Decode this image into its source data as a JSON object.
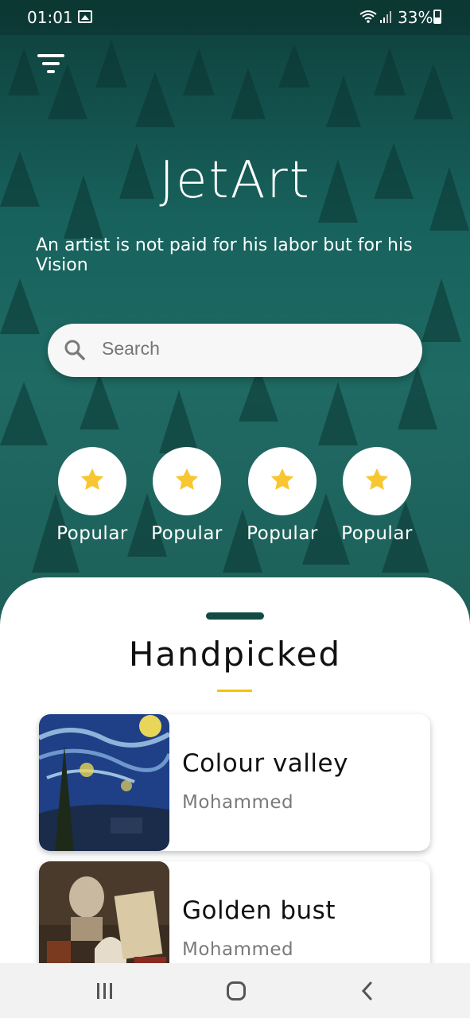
{
  "status": {
    "time": "01:01",
    "battery": "33%"
  },
  "app": {
    "title": "JetArt",
    "tagline": "An artist is not paid for his labor but for his Vision"
  },
  "search": {
    "placeholder": "Search"
  },
  "categories": [
    {
      "label": "Popular",
      "icon": "star-icon"
    },
    {
      "label": "Popular",
      "icon": "star-icon"
    },
    {
      "label": "Popular",
      "icon": "star-icon"
    },
    {
      "label": "Popular",
      "icon": "star-icon"
    }
  ],
  "section": {
    "title": "Handpicked"
  },
  "artworks": [
    {
      "title": "Colour valley",
      "artist": "Mohammed"
    },
    {
      "title": "Golden bust",
      "artist": "Mohammed"
    }
  ],
  "colors": {
    "accent": "#f5c400",
    "primary": "#144a44",
    "star": "#f8c630"
  }
}
